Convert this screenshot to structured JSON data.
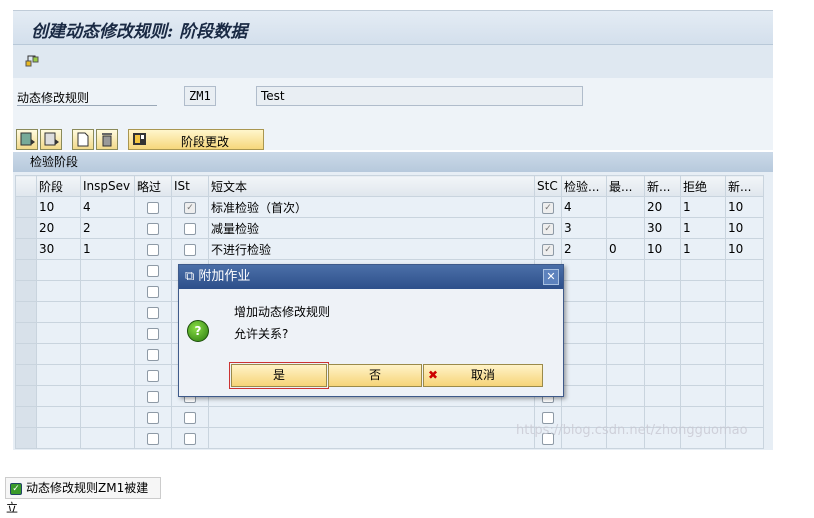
{
  "title": "创建动态修改规则: 阶段数据",
  "form": {
    "label": "动态修改规则",
    "code": "ZM1",
    "description": "Test"
  },
  "toolbar": {
    "stage_change": "阶段更改"
  },
  "group_title": "检验阶段",
  "table": {
    "headers": [
      "阶段",
      "InspSev",
      "略过",
      "ISt",
      "短文本",
      "StC",
      "检验...",
      "最...",
      "新...",
      "拒绝",
      "新..."
    ],
    "rows": [
      {
        "stage": "10",
        "insp_sev": "4",
        "skip": false,
        "ist": true,
        "text": "标准检验（首次）",
        "stc": true,
        "insp": "4",
        "max": "",
        "new1": "20",
        "reject": "1",
        "new2": "10"
      },
      {
        "stage": "20",
        "insp_sev": "2",
        "skip": false,
        "ist": false,
        "text": "减量检验",
        "stc": true,
        "insp": "3",
        "max": "",
        "new1": "30",
        "reject": "1",
        "new2": "10"
      },
      {
        "stage": "30",
        "insp_sev": "1",
        "skip": false,
        "ist": false,
        "text": "不进行检验",
        "stc": true,
        "insp": "2",
        "max": "0",
        "new1": "10",
        "reject": "1",
        "new2": "10"
      }
    ],
    "empty_rows": 9
  },
  "dialog": {
    "title": "附加作业",
    "line1": "增加动态修改规则",
    "line2": "允许关系?",
    "yes": "是",
    "no": "否",
    "cancel": "取消"
  },
  "status": "动态修改规则ZM1被建立",
  "watermark": "https://blog.csdn.net/zhongguomao"
}
